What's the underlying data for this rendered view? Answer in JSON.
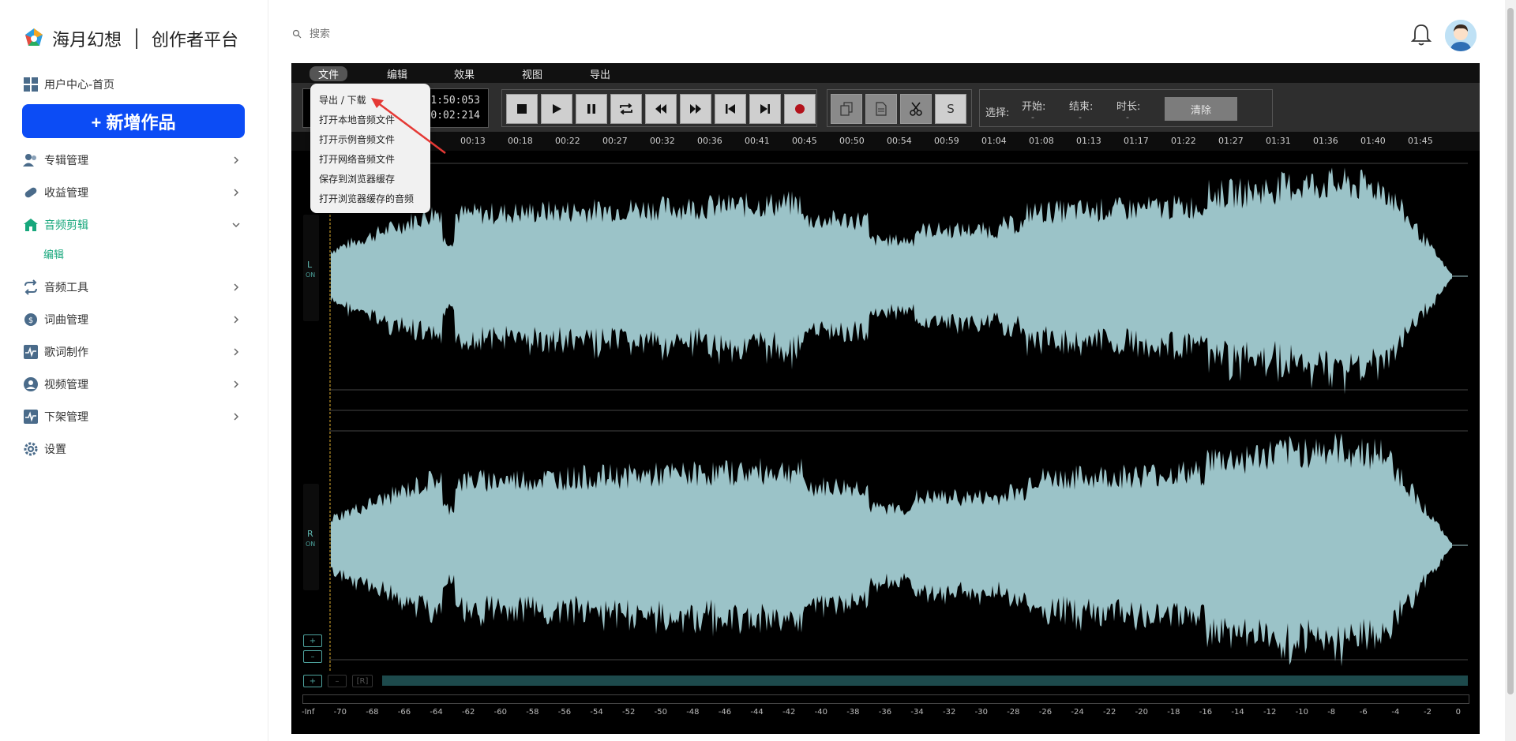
{
  "brand": {
    "name": "海月幻想",
    "platform": "创作者平台"
  },
  "sidebar": {
    "home": "用户中心-首页",
    "new_button": "+ 新增作品",
    "items": [
      {
        "label": "专辑管理"
      },
      {
        "label": "收益管理"
      },
      {
        "label": "音频剪辑",
        "sub": "编辑"
      },
      {
        "label": "音频工具"
      },
      {
        "label": "词曲管理"
      },
      {
        "label": "歌词制作"
      },
      {
        "label": "视频管理"
      },
      {
        "label": "下架管理"
      },
      {
        "label": "设置"
      }
    ],
    "accent": "#17a77c"
  },
  "header": {
    "search_placeholder": "搜索"
  },
  "editor": {
    "menus": [
      "文件",
      "编辑",
      "效果",
      "视图",
      "导出"
    ],
    "time_total": "01:50:053",
    "time_current": "00:02:214",
    "selection": {
      "label": "选择:",
      "start_label": "开始:",
      "start_value": "-",
      "end_label": "结束:",
      "end_value": "-",
      "duration_label": "时长:",
      "duration_value": "-",
      "clear": "清除"
    },
    "ruler": [
      "00:13",
      "00:18",
      "00:22",
      "00:27",
      "00:32",
      "00:36",
      "00:41",
      "00:45",
      "00:50",
      "00:54",
      "00:59",
      "01:04",
      "01:08",
      "01:13",
      "01:17",
      "01:22",
      "01:27",
      "01:31",
      "01:36",
      "01:40",
      "01:45"
    ],
    "channels": {
      "left": "L",
      "right": "R",
      "on": "ON"
    },
    "zoom": [
      "+",
      "–"
    ],
    "bottom": [
      "+",
      "–",
      "[R]"
    ],
    "db": [
      "-Inf",
      "-70",
      "-68",
      "-66",
      "-64",
      "-62",
      "-60",
      "-58",
      "-56",
      "-54",
      "-52",
      "-50",
      "-48",
      "-46",
      "-44",
      "-42",
      "-40",
      "-38",
      "-36",
      "-34",
      "-32",
      "-30",
      "-28",
      "-26",
      "-24",
      "-22",
      "-20",
      "-18",
      "-16",
      "-14",
      "-12",
      "-10",
      "-8",
      "-6",
      "-4",
      "-2",
      "0"
    ],
    "copy_icon_s": "S",
    "wave_color": "#9bc3c8"
  },
  "file_menu": [
    "导出 / 下载",
    "打开本地音频文件",
    "打开示例音频文件",
    "打开网络音频文件",
    "保存到浏览器缓存",
    "打开浏览器缓存的音频"
  ]
}
